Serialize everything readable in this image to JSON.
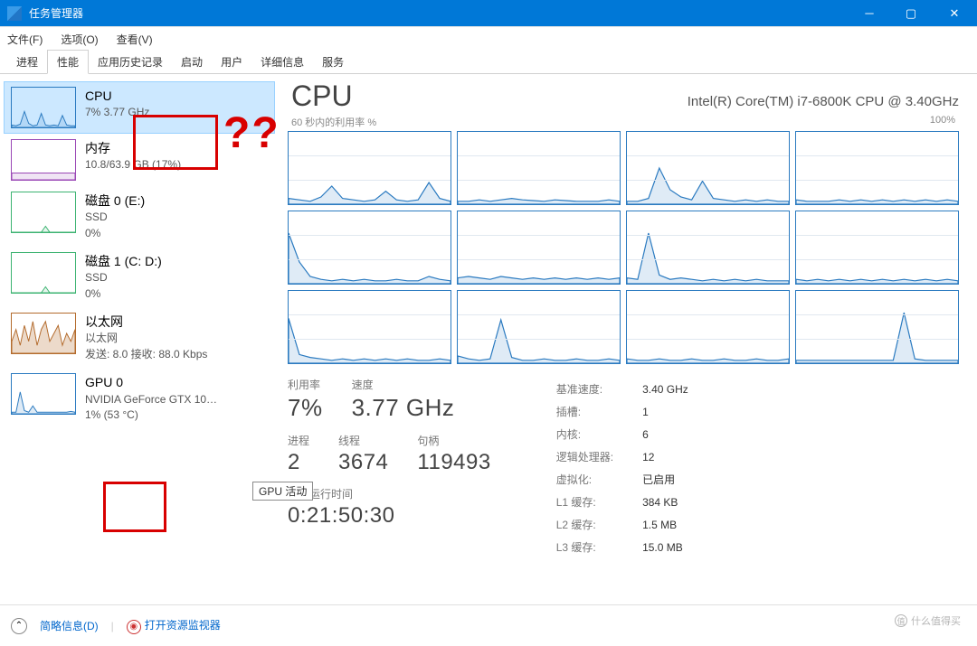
{
  "window": {
    "title": "任务管理器"
  },
  "menu": {
    "file": "文件(F)",
    "options": "选项(O)",
    "view": "查看(V)"
  },
  "tabs": [
    "进程",
    "性能",
    "应用历史记录",
    "启动",
    "用户",
    "详细信息",
    "服务"
  ],
  "activeTab": "性能",
  "sidebar": [
    {
      "name": "CPU",
      "line2": "7% 3.77 GHz",
      "line3": "",
      "thumbClass": "cpu-thumb",
      "active": true
    },
    {
      "name": "内存",
      "line2": "10.8/63.9 GB (17%)",
      "line3": "",
      "thumbClass": "mem-thumb"
    },
    {
      "name": "磁盘 0 (E:)",
      "line2": "SSD",
      "line3": "0%",
      "thumbClass": "disk-thumb"
    },
    {
      "name": "磁盘 1 (C: D:)",
      "line2": "SSD",
      "line3": "0%",
      "thumbClass": "disk-thumb"
    },
    {
      "name": "以太网",
      "line2": "以太网",
      "line3": "发送: 8.0 接收: 88.0 Kbps",
      "thumbClass": "eth-thumb"
    },
    {
      "name": "GPU 0",
      "line2": "NVIDIA GeForce GTX 10…",
      "line3": "1%  (53 °C)",
      "thumbClass": "gpu-thumb"
    }
  ],
  "main": {
    "title": "CPU",
    "model": "Intel(R) Core(TM) i7-6800K CPU @ 3.40GHz",
    "rangeLabel": "60 秒内的利用率 %",
    "rangeMax": "100%",
    "statsLeftRow1": {
      "util_label": "利用率",
      "util": "7%",
      "speed_label": "速度",
      "speed": "3.77 GHz"
    },
    "statsLeftRow2": {
      "proc_label": "进程",
      "proc": "2",
      "thr_label": "线程",
      "thr": "3674",
      "hnd_label": "句柄",
      "hnd": "119493"
    },
    "uptime_label": "正常运行时间",
    "uptime": "0:21:50:30",
    "right": [
      [
        "基准速度:",
        "3.40 GHz"
      ],
      [
        "插槽:",
        "1"
      ],
      [
        "内核:",
        "6"
      ],
      [
        "逻辑处理器:",
        "12"
      ],
      [
        "虚拟化:",
        "已启用"
      ],
      [
        "L1 缓存:",
        "384 KB"
      ],
      [
        "L2 缓存:",
        "1.5 MB"
      ],
      [
        "L3 缓存:",
        "15.0 MB"
      ]
    ]
  },
  "footer": {
    "brief": "简略信息(D)",
    "resmon": "打开资源监视器"
  },
  "tooltip": "GPU 活动",
  "watermark": "什么值得买",
  "annotation": "??",
  "chart_data": {
    "type": "line",
    "description": "12 per-logical-processor utilization sparklines over last 60s",
    "ylim": [
      0,
      100
    ],
    "xlim_seconds": 60,
    "series": [
      {
        "name": "core0",
        "values": [
          8,
          6,
          4,
          10,
          25,
          8,
          6,
          4,
          6,
          18,
          6,
          4,
          6,
          30,
          8,
          4
        ]
      },
      {
        "name": "core1",
        "values": [
          4,
          4,
          6,
          4,
          6,
          8,
          6,
          5,
          4,
          6,
          5,
          4,
          4,
          4,
          6,
          4
        ]
      },
      {
        "name": "core2",
        "values": [
          4,
          4,
          8,
          50,
          20,
          10,
          6,
          32,
          8,
          6,
          4,
          6,
          4,
          6,
          4,
          4
        ]
      },
      {
        "name": "core3",
        "values": [
          6,
          4,
          4,
          4,
          6,
          4,
          6,
          4,
          6,
          4,
          6,
          4,
          6,
          4,
          6,
          4
        ]
      },
      {
        "name": "core4",
        "values": [
          70,
          30,
          10,
          6,
          4,
          6,
          4,
          6,
          4,
          4,
          6,
          4,
          4,
          10,
          6,
          4
        ]
      },
      {
        "name": "core5",
        "values": [
          8,
          10,
          8,
          6,
          10,
          8,
          6,
          8,
          6,
          8,
          6,
          8,
          6,
          8,
          6,
          8
        ]
      },
      {
        "name": "core6",
        "values": [
          8,
          6,
          70,
          12,
          6,
          8,
          6,
          4,
          6,
          4,
          6,
          4,
          6,
          4,
          4,
          4
        ]
      },
      {
        "name": "core7",
        "values": [
          6,
          4,
          6,
          4,
          6,
          4,
          6,
          4,
          6,
          4,
          6,
          4,
          6,
          4,
          6,
          4
        ]
      },
      {
        "name": "core8",
        "values": [
          62,
          12,
          8,
          6,
          4,
          6,
          4,
          6,
          4,
          6,
          4,
          6,
          4,
          4,
          6,
          4
        ]
      },
      {
        "name": "core9",
        "values": [
          10,
          6,
          4,
          6,
          60,
          8,
          4,
          4,
          6,
          4,
          4,
          6,
          4,
          4,
          6,
          4
        ]
      },
      {
        "name": "core10",
        "values": [
          6,
          4,
          4,
          6,
          4,
          4,
          6,
          4,
          4,
          6,
          4,
          4,
          6,
          4,
          4,
          6
        ]
      },
      {
        "name": "core11",
        "values": [
          4,
          4,
          4,
          4,
          4,
          4,
          4,
          4,
          4,
          4,
          70,
          6,
          4,
          4,
          4,
          4
        ]
      }
    ]
  }
}
